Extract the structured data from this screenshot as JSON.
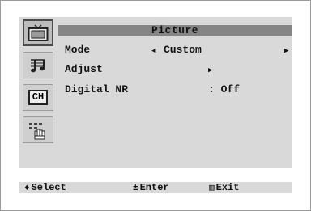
{
  "menu": {
    "title": "Picture",
    "rows": [
      {
        "label": "Mode",
        "value": "Custom"
      },
      {
        "label": "Adjust",
        "value": ""
      },
      {
        "label": "Digital NR",
        "value": ": Off"
      }
    ]
  },
  "sidebar": {
    "icons": [
      "tv-icon",
      "music-note-icon",
      "channel-icon",
      "setup-hand-icon"
    ],
    "channel_icon_text": "CH",
    "active_index": 0
  },
  "footer": {
    "select_glyph": "♦",
    "select_label": "Select",
    "enter_glyph": "±",
    "enter_label": "Enter",
    "exit_glyph": "▥",
    "exit_label": "Exit"
  },
  "glyphs": {
    "left_arrow": "◀",
    "right_arrow": "▶"
  }
}
